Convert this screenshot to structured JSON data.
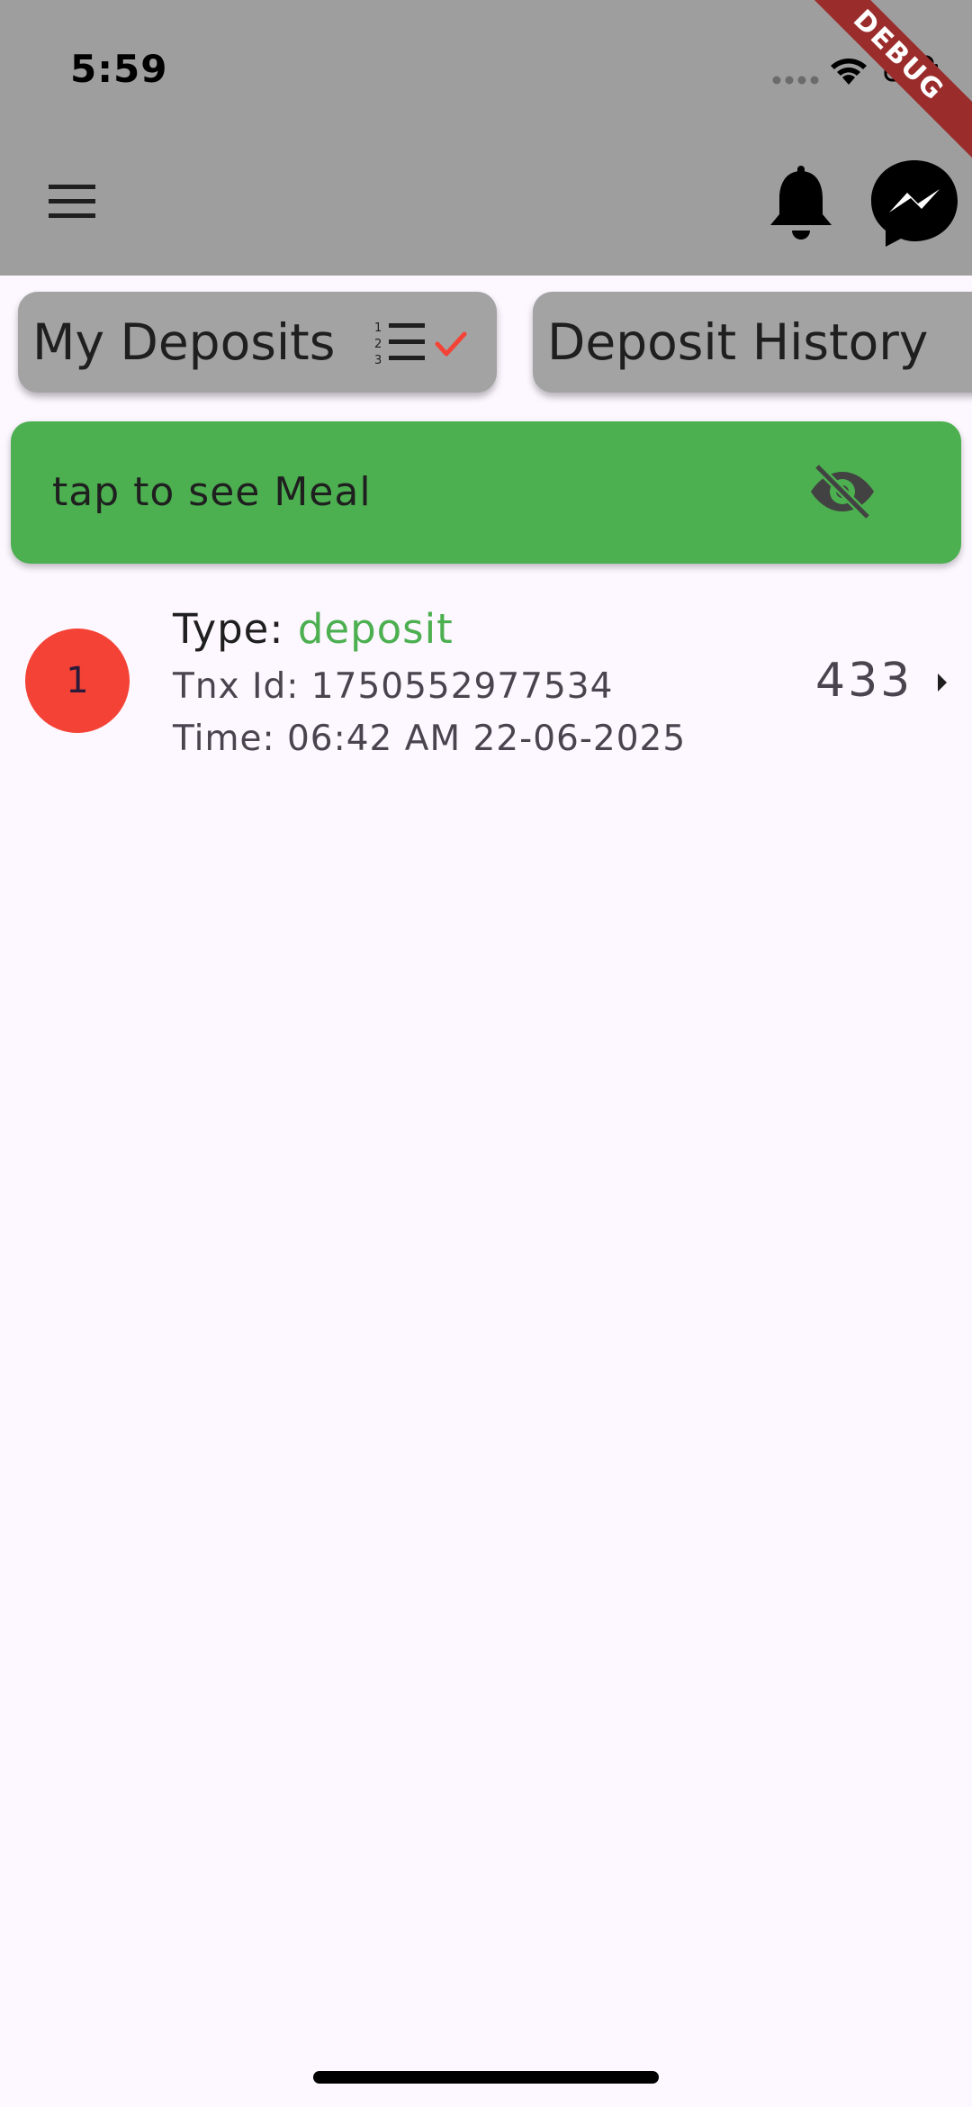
{
  "status_bar": {
    "time": "5:59"
  },
  "debug_banner": "DEBUG",
  "app_bar": {
    "menu_icon": "menu-icon",
    "notification_icon": "bell-icon",
    "messenger_icon": "messenger-icon"
  },
  "tabs": [
    {
      "label": "My Deposits",
      "icon": "list-check-icon",
      "selected": true
    },
    {
      "label": "Deposit History"
    }
  ],
  "meal_banner": {
    "label": "tap to see Meal",
    "icon": "eye-off-icon"
  },
  "transactions": [
    {
      "index": "1",
      "type_label": "Type: ",
      "type_value": "deposit",
      "tnx_id": "Tnx Id: 1750552977534",
      "time": "Time: 06:42 AM 22-06-2025",
      "amount": "433"
    }
  ],
  "colors": {
    "app_bar": "#9e9e9e",
    "chip": "#a3a3a3",
    "banner_green": "#4caf50",
    "avatar_red": "#f44336",
    "check_red": "#f44336",
    "deposit_green": "#4caf50",
    "background": "#fdf7ff"
  }
}
